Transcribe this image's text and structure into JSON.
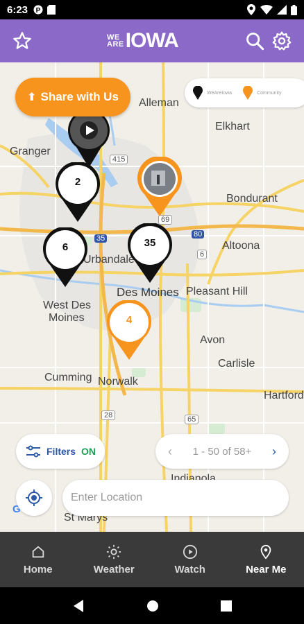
{
  "status_bar": {
    "time": "6:23"
  },
  "header": {
    "logo_small_top": "WE",
    "logo_small_bottom": "ARE",
    "logo_big": "IOWA"
  },
  "map": {
    "labels": {
      "alleman": "Alleman",
      "elkhart": "Elkhart",
      "granger": "Granger",
      "bondurant": "Bondurant",
      "altoona": "Altoona",
      "urbandale": "Urbandale",
      "des_moines": "Des Moines",
      "pleasant_hill": "Pleasant Hill",
      "west_des_moines_1": "West Des",
      "west_des_moines_2": "Moines",
      "avon": "Avon",
      "carlisle": "Carlisle",
      "cumming": "Cumming",
      "norwalk": "Norwalk",
      "hartford": "Hartford",
      "indianola": "Indianola",
      "st_marys": "St Marys",
      "hwy_415": "415",
      "hwy_69a": "69",
      "hwy_35": "35",
      "hwy_80": "80",
      "hwy_6": "6",
      "hwy_28": "28",
      "hwy_65": "65"
    },
    "pins": [
      {
        "count": "2"
      },
      {
        "count": "6"
      },
      {
        "count": "35"
      },
      {
        "count": "4"
      }
    ]
  },
  "share_button": {
    "label": "Share with Us"
  },
  "legend": {
    "item1": "WeAreIowa",
    "item2": "Community"
  },
  "filters": {
    "label": "Filters",
    "state": "ON"
  },
  "pager": {
    "range": "1 - 50 of 58+"
  },
  "location_input": {
    "placeholder": "Enter Location"
  },
  "bottom_nav": [
    {
      "label": "Home"
    },
    {
      "label": "Weather"
    },
    {
      "label": "Watch"
    },
    {
      "label": "Near Me"
    }
  ],
  "colors": {
    "header": "#8b69c9",
    "accent_orange": "#f7941d",
    "nav_bg": "#3a3a3a"
  }
}
